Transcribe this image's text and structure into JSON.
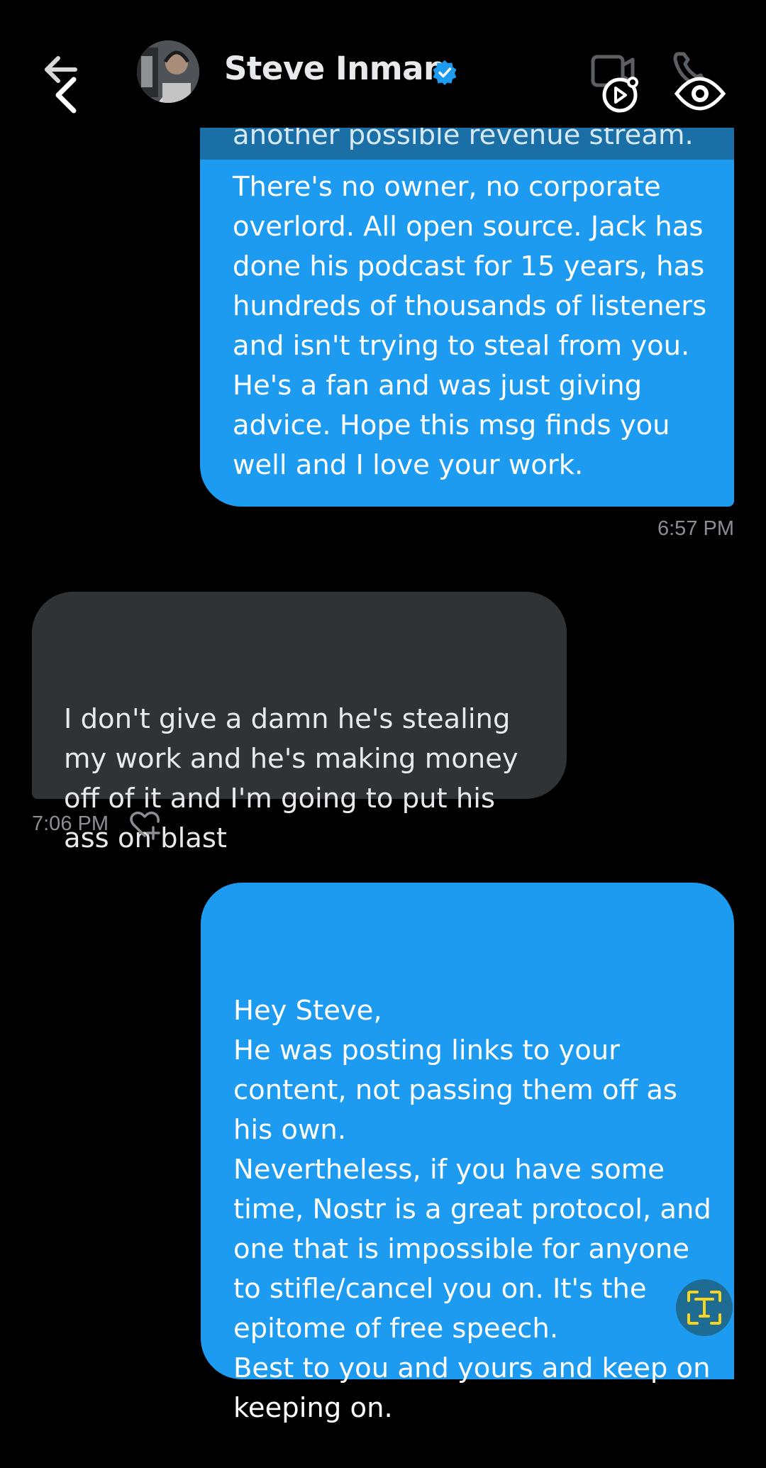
{
  "header": {
    "contact_name": "Steve Inman",
    "verified": true,
    "back_icon": "back-arrow-icon",
    "video_icon": "video-call-icon",
    "call_icon": "phone-call-icon",
    "accent_color": "#1d9bf0"
  },
  "messages": [
    {
      "direction": "outgoing",
      "cut_off_text": "another possible revenue stream.",
      "text": "There's no owner, no corporate overlord. All open source. Jack has done his podcast for 15 years, has hundreds of thousands of listeners and isn't trying to steal from you. He's a fan and was just giving advice. Hope this msg finds you well and I love your work.",
      "time": "6:57 PM"
    },
    {
      "direction": "incoming",
      "text": "I don't give a damn he's stealing my work and he's making money off of it and I'm going to put his ass on blast",
      "time": "7:06 PM"
    },
    {
      "direction": "outgoing",
      "text": "Hey Steve,\nHe was posting links to your content, not passing them off as his own.\nNevertheless, if you have some time, Nostr is a great protocol, and one that is impossible for anyone to stifle/cancel you on. It's the epitome of free speech.\nBest to you and yours and keep on keeping on."
    }
  ],
  "overlays": {
    "text_recognition_icon": "text-recognition-icon",
    "eye_icon": "eye-icon",
    "like_icon": "heart-plus-icon"
  }
}
